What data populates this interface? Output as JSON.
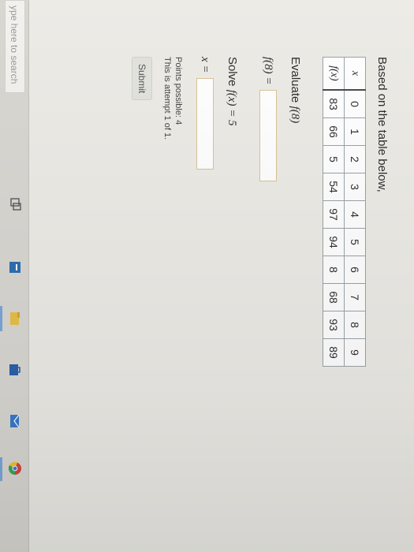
{
  "question": {
    "prompt": "Based on the table below,",
    "table": {
      "x_header": "x",
      "fx_header": "f(x)",
      "x_values": [
        "0",
        "1",
        "2",
        "3",
        "4",
        "5",
        "6",
        "7",
        "8",
        "9"
      ],
      "fx_values": [
        "83",
        "66",
        "5",
        "54",
        "97",
        "94",
        "8",
        "68",
        "93",
        "89"
      ]
    },
    "part1": {
      "instruction_prefix": "Evaluate ",
      "instruction_math": "f(8)",
      "answer_label": "f(8) =",
      "answer_value": ""
    },
    "part2": {
      "instruction_prefix": "Solve ",
      "instruction_math": "f(x) = 5",
      "answer_label": "x =",
      "answer_value": ""
    },
    "points_possible": "Points possible: 4",
    "attempt_info": "This is attempt 1 of 1.",
    "submit_label": "Submit"
  },
  "taskbar": {
    "search_placeholder": "ype here to search",
    "icons": [
      "task-view-icon",
      "edge-browser-icon",
      "file-explorer-icon",
      "store-icon",
      "mail-icon",
      "chrome-icon"
    ]
  },
  "colors": {
    "page_background": "#ecebe6",
    "input_border": "#d8c59a",
    "taskbar": "#d9d7d2"
  }
}
